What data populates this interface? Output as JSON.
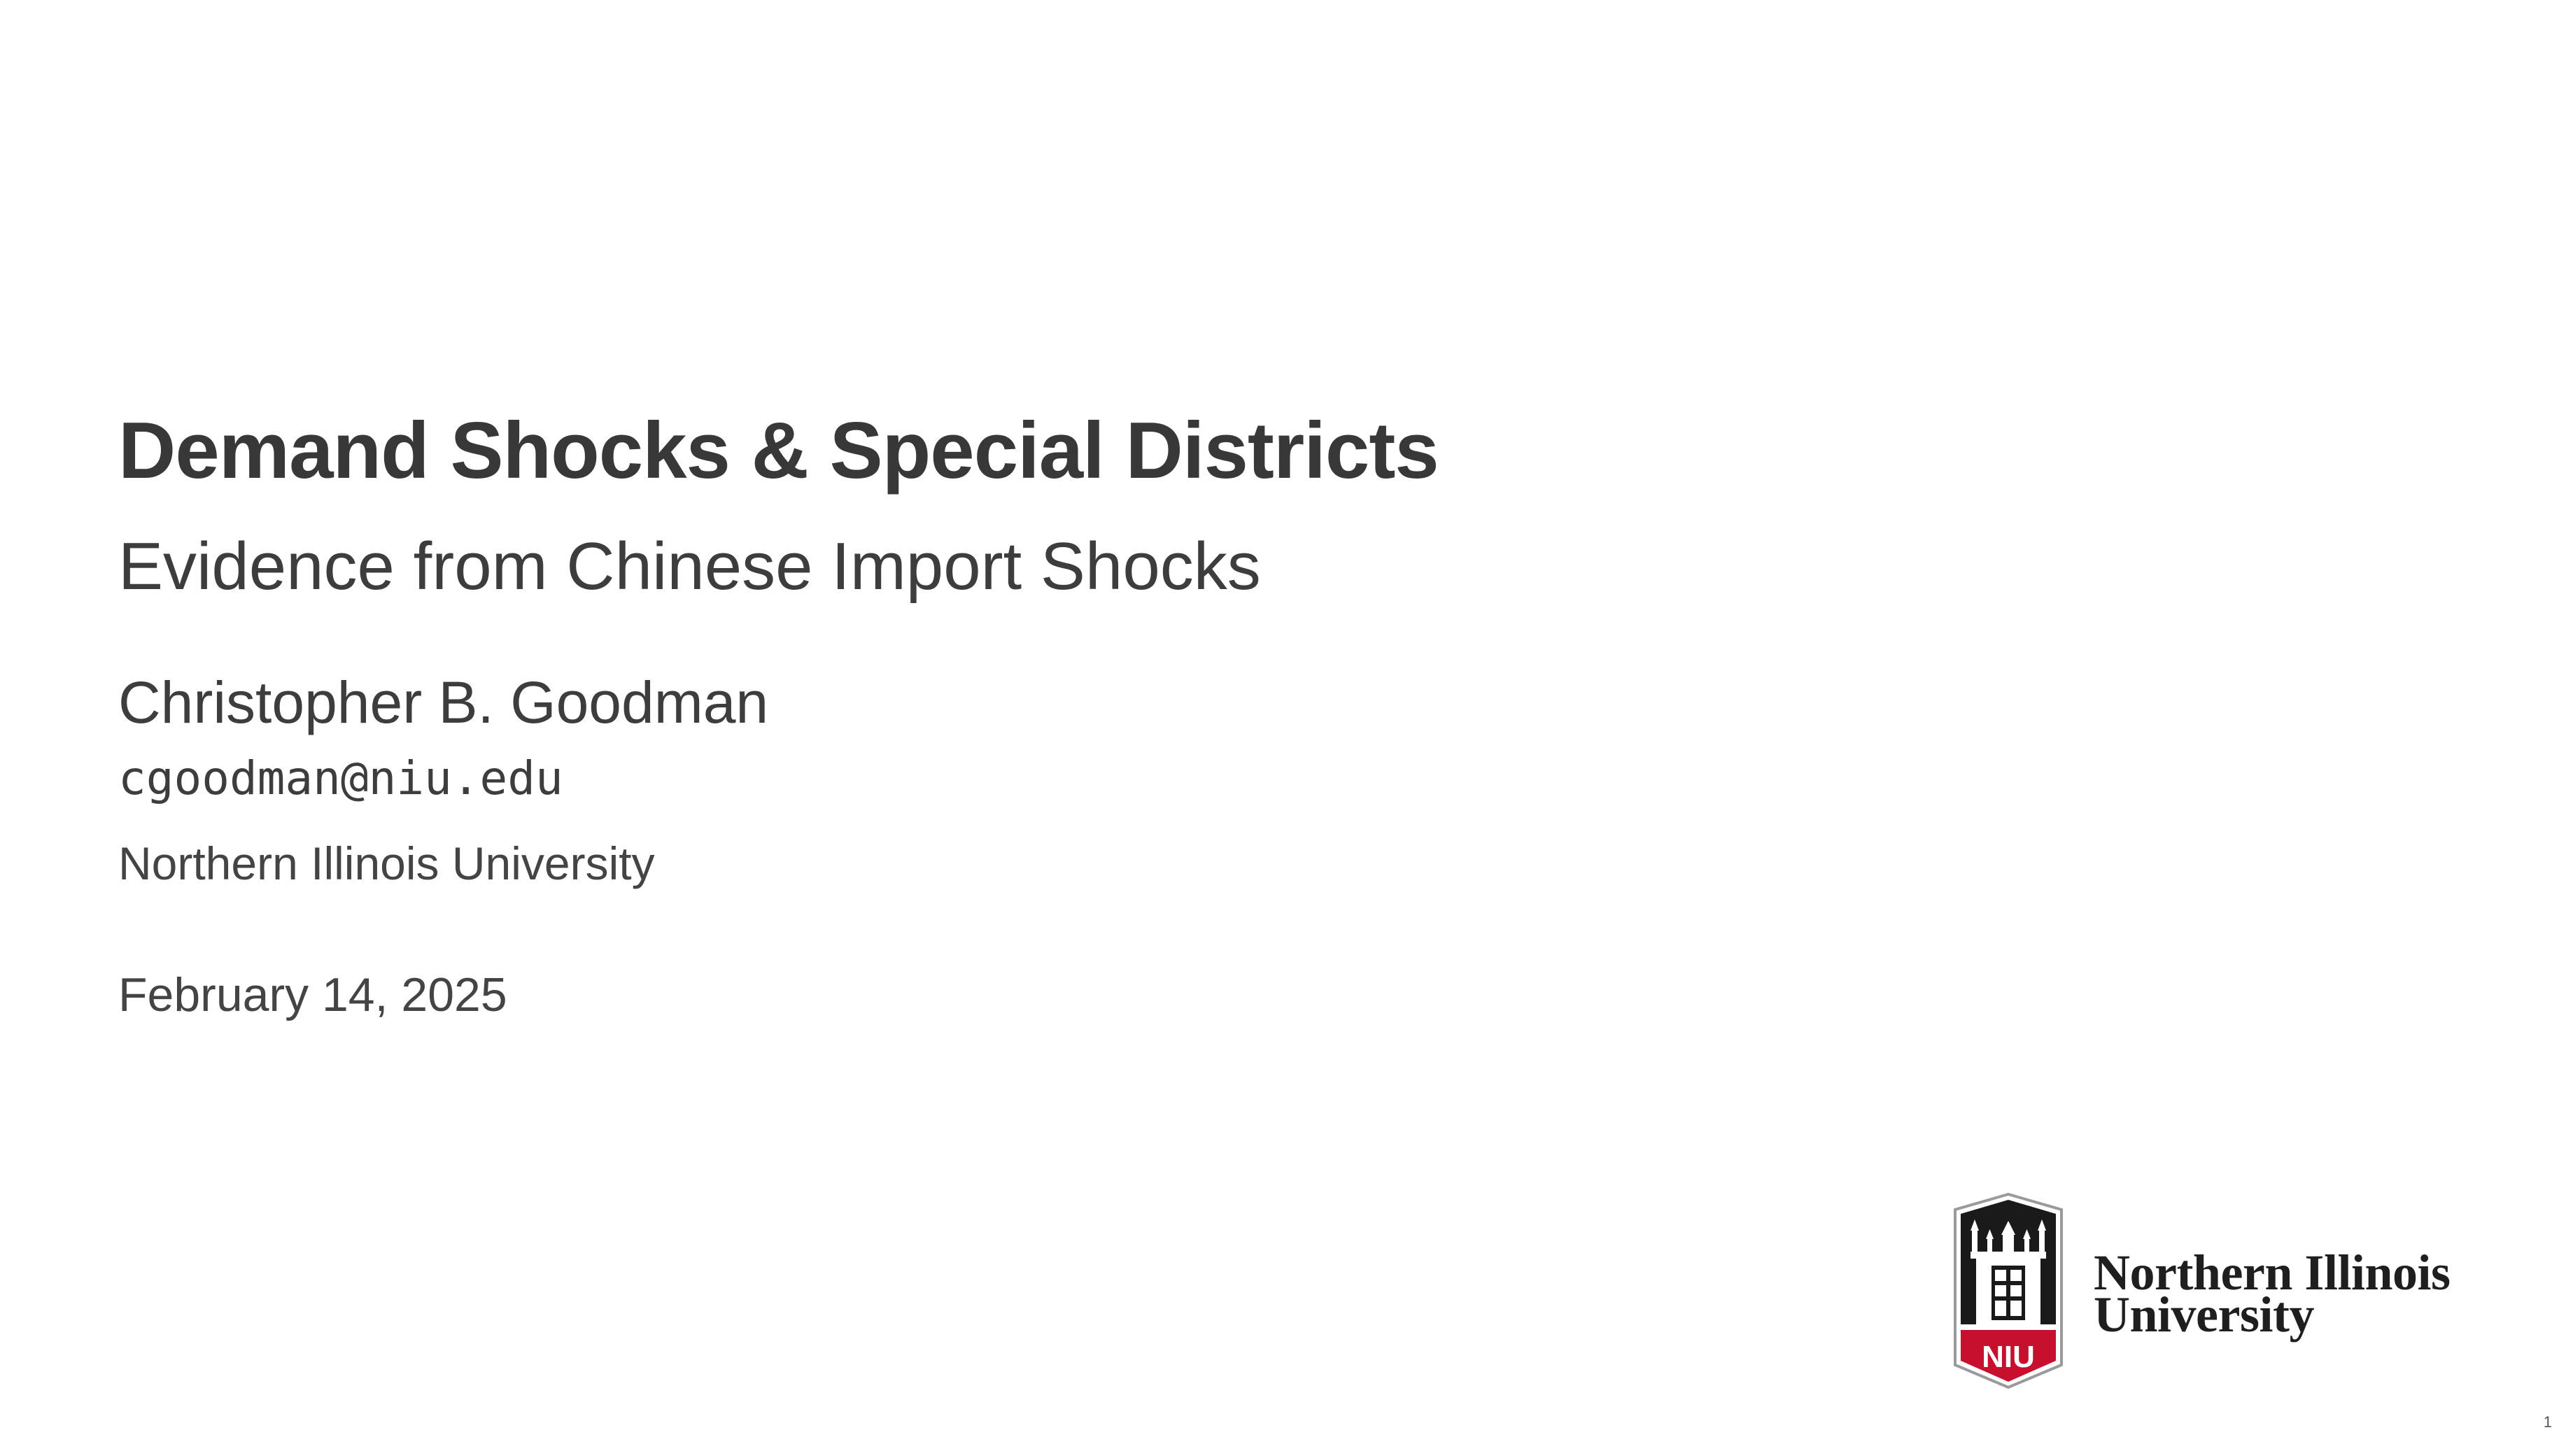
{
  "slide": {
    "title": "Demand Shocks & Special Districts",
    "subtitle": "Evidence from Chinese Import Shocks",
    "author": "Christopher B. Goodman",
    "email": "cgoodman@niu.edu",
    "institution": "Northern Illinois University",
    "date": "February 14, 2025",
    "page_number": "1"
  },
  "logo": {
    "icon": "niu-tower-shield-icon",
    "badge_text": "NIU",
    "wordmark_line1": "Northern Illinois",
    "wordmark_line2": "University",
    "colors": {
      "black": "#1a1a1a",
      "red": "#c8102e",
      "white": "#ffffff"
    }
  }
}
